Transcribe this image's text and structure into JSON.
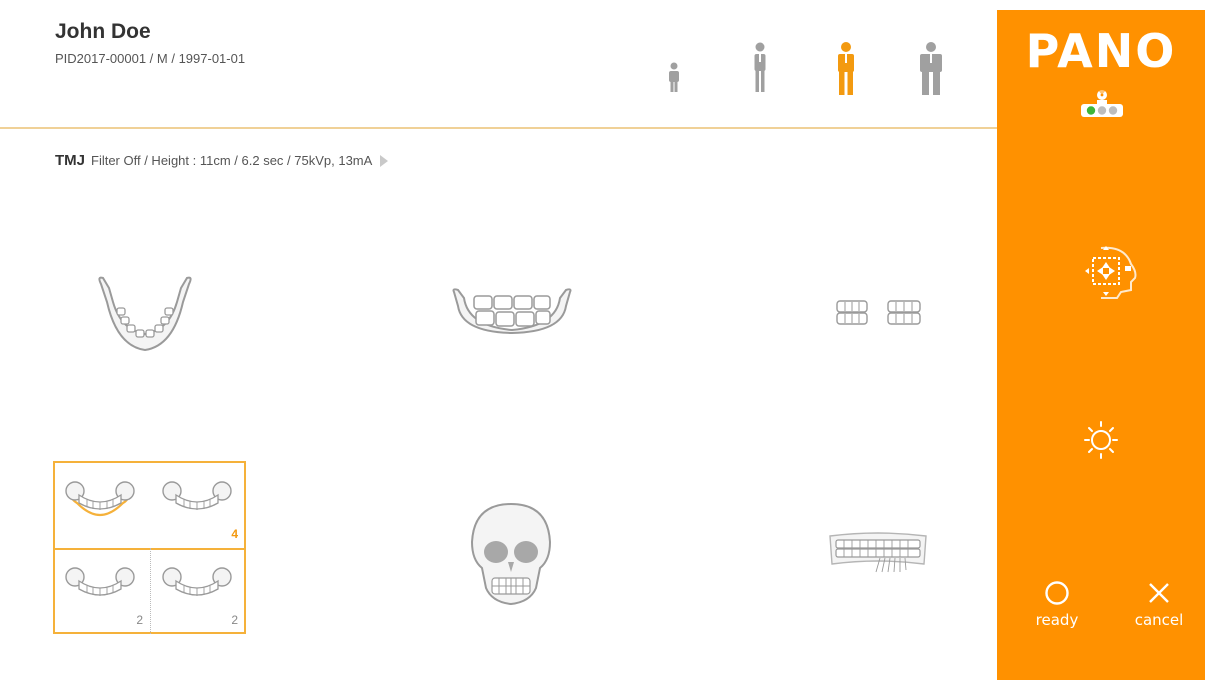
{
  "patient": {
    "name": "John Doe",
    "info": "PID2017-00001 / M / 1997-01-01"
  },
  "patient_sizes": {
    "options": [
      "child",
      "small-adult",
      "medium-adult",
      "large-adult"
    ],
    "selected": "medium-adult",
    "selected_color": "#f39a10",
    "default_color": "#a0a0a0"
  },
  "protocol": {
    "mode": "TMJ",
    "params": "Filter Off / Height : 11cm / 6.2 sec / 75kVp, 13mA"
  },
  "tmj_grid": {
    "cells": [
      {
        "name": "tmj-open-lateral",
        "count": "",
        "selected": true
      },
      {
        "name": "tmj-closed-lateral",
        "count": "4",
        "selected": false
      },
      {
        "name": "tmj-open-pa",
        "count": "2",
        "selected": false
      },
      {
        "name": "tmj-closed-pa",
        "count": "2",
        "selected": false
      }
    ]
  },
  "side_panel": {
    "mode_title": "PANO",
    "accent": "#ff9100",
    "indicator_lights": [
      "green",
      "grey",
      "grey"
    ],
    "ready_label": "ready",
    "cancel_label": "cancel"
  }
}
